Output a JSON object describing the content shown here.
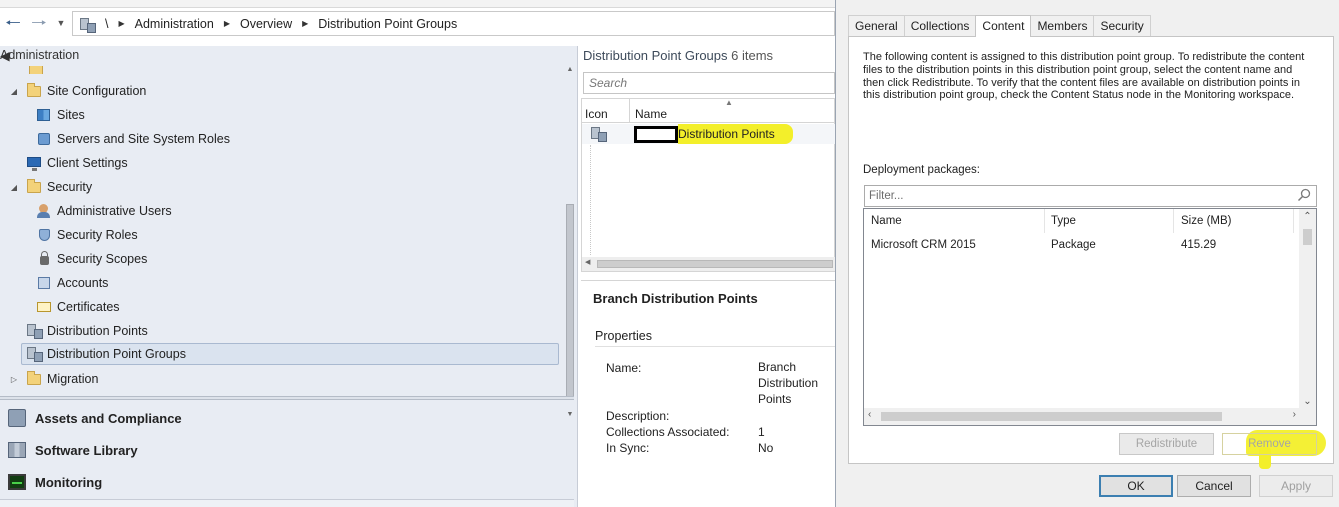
{
  "nav": {
    "back_icon": "back-arrow-icon",
    "forward_icon": "forward-arrow-icon",
    "dropdown_icon": "chevron-down-icon",
    "breadcrumb": [
      "\\",
      "Administration",
      "Overview",
      "Distribution Point Groups"
    ]
  },
  "leftnav": {
    "title": "Administration",
    "tree": [
      {
        "label": "Site Configuration",
        "icon": "folder-icon",
        "expanded": true
      },
      {
        "label": "Sites",
        "icon": "sites-icon"
      },
      {
        "label": "Servers and Site System Roles",
        "icon": "server-icon"
      },
      {
        "label": "Client Settings",
        "icon": "monitor-icon"
      },
      {
        "label": "Security",
        "icon": "folder-icon",
        "expanded": true
      },
      {
        "label": "Administrative Users",
        "icon": "user-icon"
      },
      {
        "label": "Security Roles",
        "icon": "shield-icon"
      },
      {
        "label": "Security Scopes",
        "icon": "lock-icon"
      },
      {
        "label": "Accounts",
        "icon": "book-icon"
      },
      {
        "label": "Certificates",
        "icon": "certificate-icon"
      },
      {
        "label": "Distribution Points",
        "icon": "distribution-point-icon"
      },
      {
        "label": "Distribution Point Groups",
        "icon": "distribution-point-group-icon",
        "selected": true
      },
      {
        "label": "Migration",
        "icon": "folder-icon",
        "expanded": false
      }
    ],
    "workspaces": [
      {
        "label": "Assets and Compliance",
        "icon": "assets-icon"
      },
      {
        "label": "Software Library",
        "icon": "library-icon"
      },
      {
        "label": "Monitoring",
        "icon": "monitoring-icon"
      }
    ]
  },
  "list": {
    "title": "Distribution Point Groups",
    "count": "6 items",
    "search_placeholder": "Search",
    "columns": [
      "Icon",
      "Name"
    ],
    "rows": [
      {
        "name": "Distribution Points",
        "highlight_color": "#f3ef2a"
      }
    ]
  },
  "details": {
    "title": "Branch Distribution Points",
    "section": "Properties",
    "props": [
      {
        "label": "Name:",
        "value": "Branch\nDistribution\nPoints"
      },
      {
        "label": "Description:",
        "value": ""
      },
      {
        "label": "Collections Associated:",
        "value": "1"
      },
      {
        "label": "In Sync:",
        "value": "No"
      }
    ]
  },
  "dialog": {
    "tabs": [
      "General",
      "Collections",
      "Content",
      "Members",
      "Security"
    ],
    "active_tab": "Content",
    "description": "The following content is assigned to this distribution point group. To redistribute the content files to the distribution points in this distribution point group, select the content name and then click Redistribute. To verify that the content files are available on distribution points in this distribution point group, check the Content Status node in the Monitoring workspace.",
    "deployment_label": "Deployment packages:",
    "filter_placeholder": "Filter...",
    "columns": [
      "Name",
      "Type",
      "Size (MB)"
    ],
    "rows": [
      {
        "name": "Microsoft CRM 2015",
        "type": "Package",
        "size": "415.29"
      }
    ],
    "redistribute_label": "Redistribute",
    "remove_label": "Remove",
    "ok_label": "OK",
    "cancel_label": "Cancel",
    "apply_label": "Apply",
    "accent_color": "#3c7fb1"
  }
}
